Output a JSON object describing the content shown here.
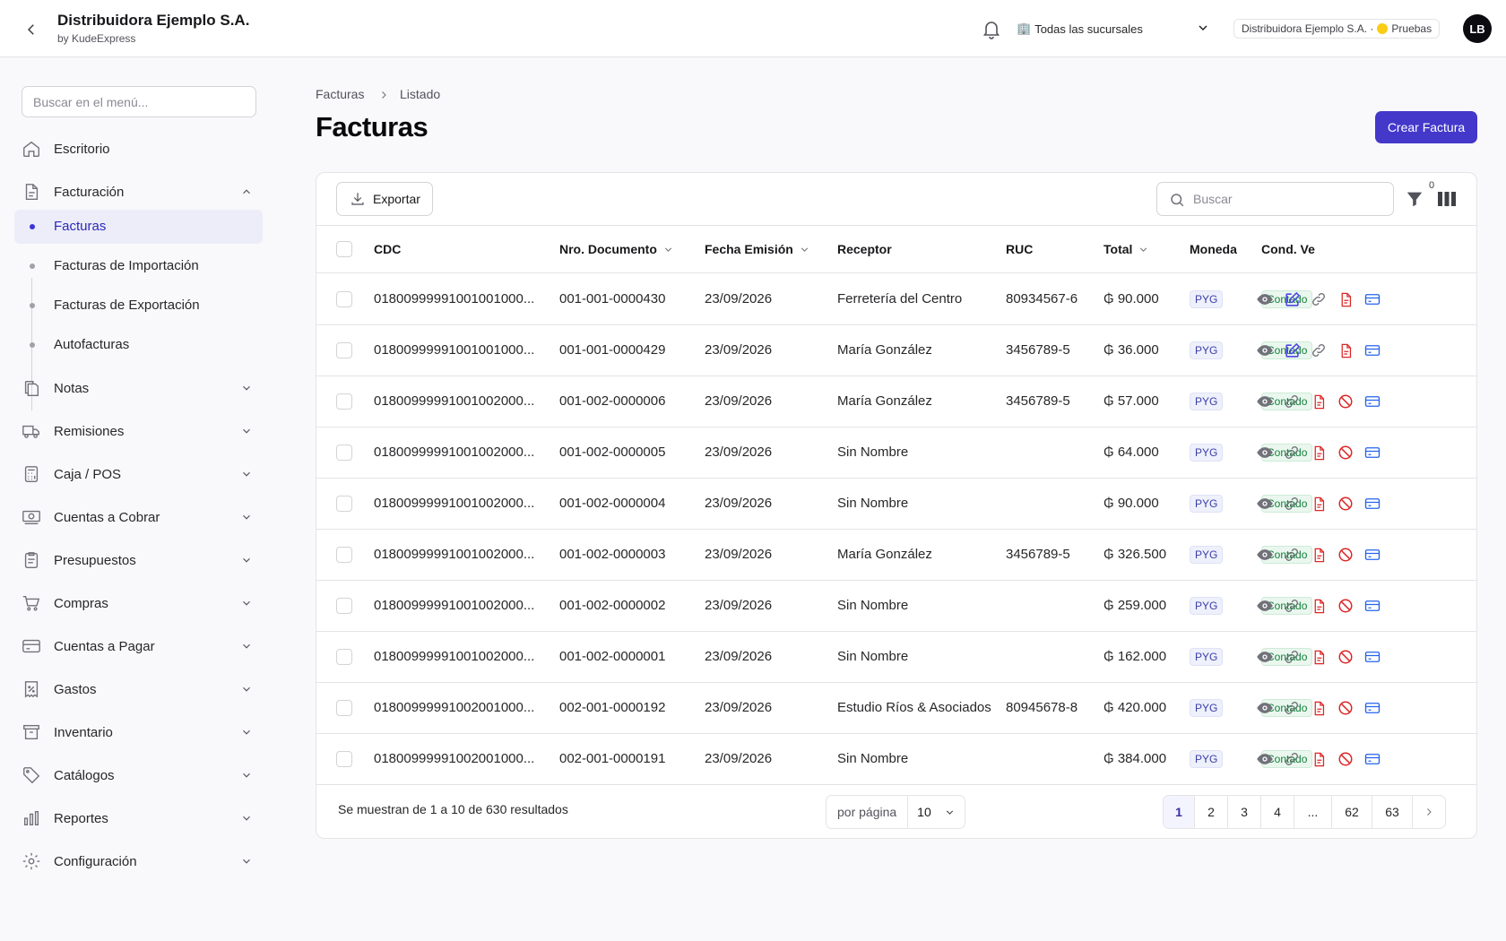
{
  "header": {
    "company_name": "Distribuidora Ejemplo S.A.",
    "company_sub": "by KudeExpress",
    "branch_select": "Todas las sucursales",
    "branch_icon": "🏢",
    "company_badge": "Distribuidora Ejemplo S.A. ·",
    "env_label": "Pruebas",
    "avatar_initials": "LB"
  },
  "sidebar": {
    "search_placeholder": "Buscar en el menú...",
    "items": [
      {
        "label": "Escritorio",
        "icon": "home-icon"
      },
      {
        "label": "Facturación",
        "icon": "document-icon"
      },
      {
        "label": "Notas",
        "icon": "copy-icon"
      },
      {
        "label": "Remisiones",
        "icon": "truck-icon"
      },
      {
        "label": "Caja / POS",
        "icon": "calculator-icon"
      },
      {
        "label": "Cuentas a Cobrar",
        "icon": "cash-icon"
      },
      {
        "label": "Presupuestos",
        "icon": "clipboard-icon"
      },
      {
        "label": "Compras",
        "icon": "cart-icon"
      },
      {
        "label": "Cuentas a Pagar",
        "icon": "credit-card-icon"
      },
      {
        "label": "Gastos",
        "icon": "receipt-percent-icon"
      },
      {
        "label": "Inventario",
        "icon": "archive-box-icon"
      },
      {
        "label": "Catálogos",
        "icon": "tag-icon"
      },
      {
        "label": "Reportes",
        "icon": "bar-chart-icon"
      },
      {
        "label": "Configuración",
        "icon": "gear-icon"
      }
    ],
    "subitems": [
      {
        "label": "Facturas"
      },
      {
        "label": "Facturas de Importación"
      },
      {
        "label": "Facturas de Exportación"
      },
      {
        "label": "Autofacturas"
      }
    ]
  },
  "breadcrumb": {
    "root": "Facturas",
    "current": "Listado"
  },
  "page": {
    "title": "Facturas",
    "create_label": "Crear Factura"
  },
  "toolbar": {
    "export_label": "Exportar",
    "search_placeholder": "Buscar",
    "filter_count": "0"
  },
  "table": {
    "columns": [
      "CDC",
      "Nro. Documento",
      "Fecha Emisión",
      "Receptor",
      "RUC",
      "Total",
      "Moneda",
      "Cond. Ve"
    ],
    "rows": [
      {
        "cdc": "01800999991001001000...",
        "nro": "001-001-0000430",
        "fecha": "23/09/2026",
        "receptor": "Ferretería del Centro",
        "ruc": "80934567-6",
        "total": "₲ 90.000",
        "moneda": "PYG",
        "cond": "Contado"
      },
      {
        "cdc": "01800999991001001000...",
        "nro": "001-001-0000429",
        "fecha": "23/09/2026",
        "receptor": "María González",
        "ruc": "3456789-5",
        "total": "₲ 36.000",
        "moneda": "PYG",
        "cond": "Contado"
      },
      {
        "cdc": "01800999991001002000...",
        "nro": "001-002-0000006",
        "fecha": "23/09/2026",
        "receptor": "María González",
        "ruc": "3456789-5",
        "total": "₲ 57.000",
        "moneda": "PYG",
        "cond": "Contado"
      },
      {
        "cdc": "01800999991001002000...",
        "nro": "001-002-0000005",
        "fecha": "23/09/2026",
        "receptor": "Sin Nombre",
        "ruc": "",
        "total": "₲ 64.000",
        "moneda": "PYG",
        "cond": "Contado"
      },
      {
        "cdc": "01800999991001002000...",
        "nro": "001-002-0000004",
        "fecha": "23/09/2026",
        "receptor": "Sin Nombre",
        "ruc": "",
        "total": "₲ 90.000",
        "moneda": "PYG",
        "cond": "Contado"
      },
      {
        "cdc": "01800999991001002000...",
        "nro": "001-002-0000003",
        "fecha": "23/09/2026",
        "receptor": "María González",
        "ruc": "3456789-5",
        "total": "₲ 326.500",
        "moneda": "PYG",
        "cond": "Contado"
      },
      {
        "cdc": "01800999991001002000...",
        "nro": "001-002-0000002",
        "fecha": "23/09/2026",
        "receptor": "Sin Nombre",
        "ruc": "",
        "total": "₲ 259.000",
        "moneda": "PYG",
        "cond": "Contado"
      },
      {
        "cdc": "01800999991001002000...",
        "nro": "001-002-0000001",
        "fecha": "23/09/2026",
        "receptor": "Sin Nombre",
        "ruc": "",
        "total": "₲ 162.000",
        "moneda": "PYG",
        "cond": "Contado"
      },
      {
        "cdc": "01800999991002001000...",
        "nro": "002-001-0000192",
        "fecha": "23/09/2026",
        "receptor": "Estudio Ríos & Asociados",
        "ruc": "80945678-8",
        "total": "₲ 420.000",
        "moneda": "PYG",
        "cond": "Contado"
      },
      {
        "cdc": "01800999991002001000...",
        "nro": "002-001-0000191",
        "fecha": "23/09/2026",
        "receptor": "Sin Nombre",
        "ruc": "",
        "total": "₲ 384.000",
        "moneda": "PYG",
        "cond": "Contado"
      }
    ],
    "row_actions": [
      [
        "view-icon",
        "edit-icon",
        "link-icon",
        "pdf-icon",
        "payment-icon"
      ],
      [
        "view-icon",
        "edit-icon",
        "link-icon",
        "pdf-icon",
        "payment-icon"
      ],
      [
        "view-icon",
        "link-icon",
        "pdf-icon",
        "cancel-icon",
        "payment-icon"
      ],
      [
        "view-icon",
        "link-icon",
        "pdf-icon",
        "cancel-icon",
        "payment-icon"
      ],
      [
        "view-icon",
        "link-icon",
        "pdf-icon",
        "cancel-icon",
        "payment-icon"
      ],
      [
        "view-icon",
        "link-icon",
        "pdf-icon",
        "cancel-icon",
        "payment-icon"
      ],
      [
        "view-icon",
        "link-icon",
        "pdf-icon",
        "cancel-icon",
        "payment-icon"
      ],
      [
        "view-icon",
        "link-icon",
        "pdf-icon",
        "cancel-icon",
        "payment-icon"
      ],
      [
        "view-icon",
        "link-icon",
        "pdf-icon",
        "cancel-icon",
        "payment-icon"
      ],
      [
        "view-icon",
        "link-icon",
        "pdf-icon",
        "cancel-icon",
        "payment-icon"
      ]
    ]
  },
  "footer": {
    "results_text": "Se muestran de 1 a 10 de 630 resultados",
    "per_page_label": "por página",
    "per_page_value": "10",
    "pages": [
      "1",
      "2",
      "3",
      "4",
      "...",
      "62",
      "63"
    ],
    "active_page": "1"
  },
  "colors": {
    "primary": "#4338ca",
    "icon_gray": "#71717a",
    "icon_blue": "#4f46e5",
    "icon_red": "#dc2626",
    "icon_payment": "#2563eb"
  }
}
